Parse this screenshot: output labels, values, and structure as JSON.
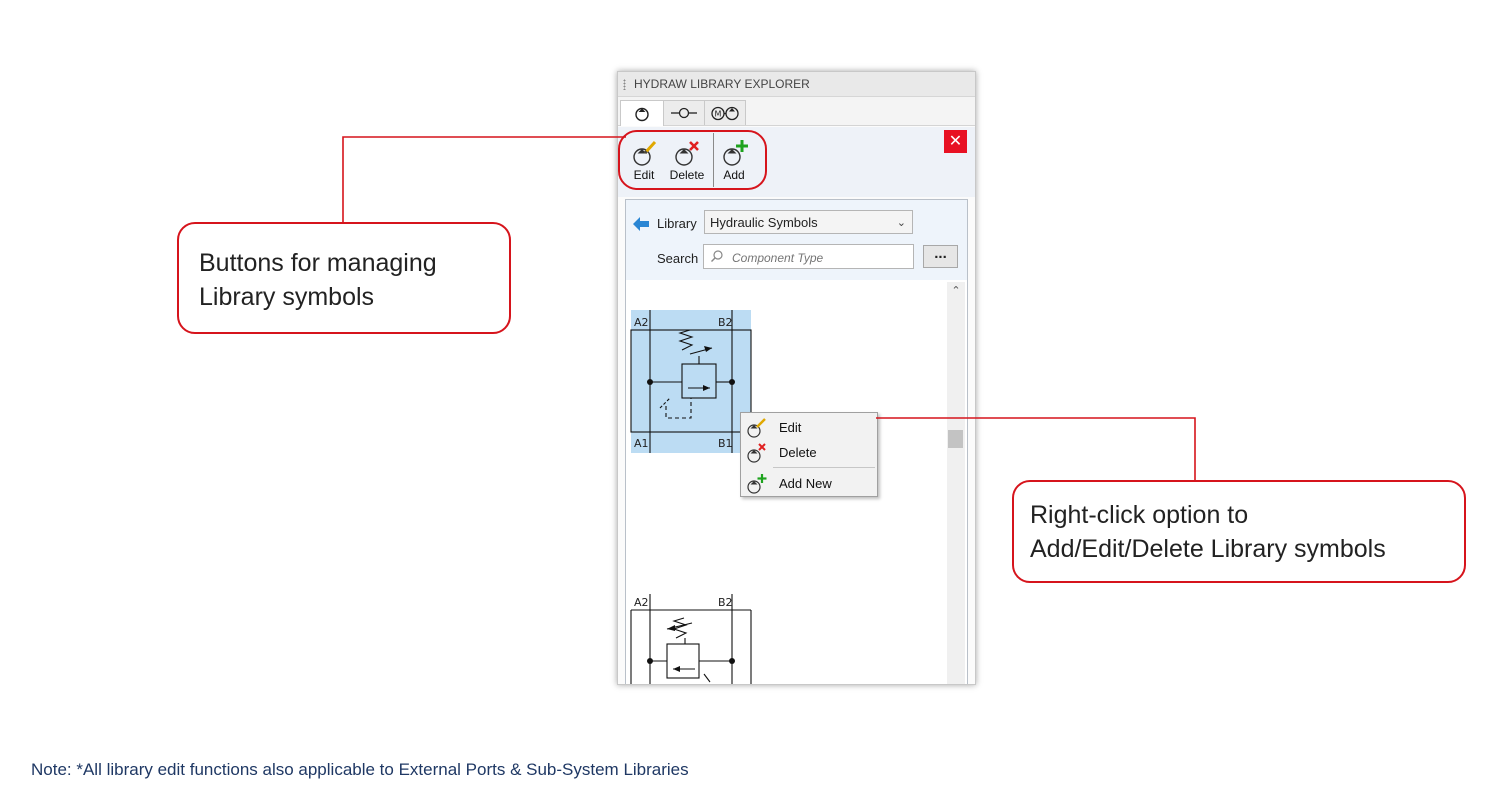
{
  "window": {
    "title": "HYDRAW LIBRARY EXPLORER",
    "close_label": "✕"
  },
  "tabs": [
    {
      "name": "components-tab",
      "active": true
    },
    {
      "name": "external-ports-tab",
      "active": false
    },
    {
      "name": "sub-systems-tab",
      "active": false
    }
  ],
  "toolbar": {
    "edit_label": "Edit",
    "delete_label": "Delete",
    "add_label": "Add"
  },
  "library": {
    "back_icon": "arrow-left-icon",
    "label": "Library",
    "selected": "Hydraulic Symbols",
    "search_label": "Search",
    "search_placeholder": "Component Type",
    "more_label": "..."
  },
  "symbols": [
    {
      "ports": {
        "top_left": "A2",
        "top_right": "B2",
        "bottom_left": "A1",
        "bottom_right": "B1"
      },
      "selected": true
    },
    {
      "ports": {
        "top_left": "A2",
        "top_right": "B2"
      },
      "selected": false
    }
  ],
  "context_menu": {
    "edit": "Edit",
    "delete": "Delete",
    "add_new": "Add New"
  },
  "callouts": {
    "left_line1": "Buttons for managing",
    "left_line2": "Library symbols",
    "right_line1": "Right-click option to",
    "right_line2": "Add/Edit/Delete Library symbols"
  },
  "note": "Note: *All library edit functions also applicable to External Ports & Sub-System Libraries",
  "colors": {
    "accent_red": "#d6141c",
    "selection_blue": "#bcdcf3",
    "close_red": "#e81123",
    "note_blue": "#1f3864"
  }
}
